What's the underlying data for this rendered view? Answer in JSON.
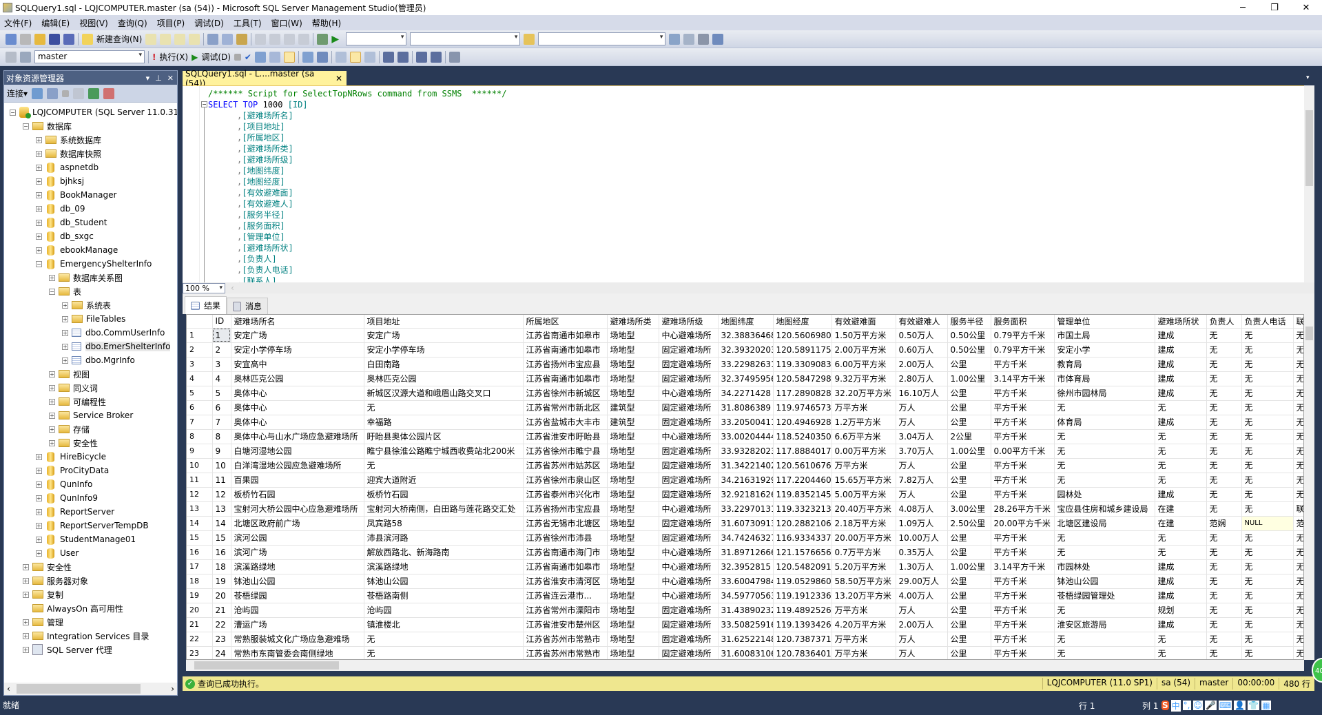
{
  "window": {
    "title": "SQLQuery1.sql - LQJCOMPUTER.master (sa (54)) - Microsoft SQL Server Management Studio(管理员)"
  },
  "menu": [
    "文件(F)",
    "编辑(E)",
    "视图(V)",
    "查询(Q)",
    "项目(P)",
    "调试(D)",
    "工具(T)",
    "窗口(W)",
    "帮助(H)"
  ],
  "toolbar1": {
    "new_query": "新建查询(N)"
  },
  "toolbar2": {
    "database": "master",
    "execute": "执行(X)",
    "debug": "调试(D)"
  },
  "object_explorer": {
    "title": "对象资源管理器",
    "connect": "连接",
    "tree": [
      {
        "label": "LQJCOMPUTER (SQL Server 11.0.31",
        "level": 0,
        "icon": "server",
        "state": "expanded"
      },
      {
        "label": "数据库",
        "level": 1,
        "icon": "folder",
        "state": "expanded"
      },
      {
        "label": "系统数据库",
        "level": 2,
        "icon": "folder",
        "state": "collapsed"
      },
      {
        "label": "数据库快照",
        "level": 2,
        "icon": "folder",
        "state": "collapsed"
      },
      {
        "label": "aspnetdb",
        "level": 2,
        "icon": "database",
        "state": "collapsed"
      },
      {
        "label": "bjhksj",
        "level": 2,
        "icon": "database",
        "state": "collapsed"
      },
      {
        "label": "BookManager",
        "level": 2,
        "icon": "database",
        "state": "collapsed"
      },
      {
        "label": "db_09",
        "level": 2,
        "icon": "database",
        "state": "collapsed"
      },
      {
        "label": "db_Student",
        "level": 2,
        "icon": "database",
        "state": "collapsed"
      },
      {
        "label": "db_sxgc",
        "level": 2,
        "icon": "database",
        "state": "collapsed"
      },
      {
        "label": "ebookManage",
        "level": 2,
        "icon": "database",
        "state": "collapsed"
      },
      {
        "label": "EmergencyShelterInfo",
        "level": 2,
        "icon": "database",
        "state": "expanded"
      },
      {
        "label": "数据库关系图",
        "level": 3,
        "icon": "folder",
        "state": "collapsed"
      },
      {
        "label": "表",
        "level": 3,
        "icon": "folder",
        "state": "expanded"
      },
      {
        "label": "系统表",
        "level": 4,
        "icon": "folder",
        "state": "collapsed"
      },
      {
        "label": "FileTables",
        "level": 4,
        "icon": "folder",
        "state": "collapsed"
      },
      {
        "label": "dbo.CommUserInfo",
        "level": 4,
        "icon": "table",
        "state": "collapsed"
      },
      {
        "label": "dbo.EmerShelterInfo",
        "level": 4,
        "icon": "table",
        "state": "collapsed",
        "selected": true
      },
      {
        "label": "dbo.MgrInfo",
        "level": 4,
        "icon": "table",
        "state": "collapsed"
      },
      {
        "label": "视图",
        "level": 3,
        "icon": "folder",
        "state": "collapsed"
      },
      {
        "label": "同义词",
        "level": 3,
        "icon": "folder",
        "state": "collapsed"
      },
      {
        "label": "可编程性",
        "level": 3,
        "icon": "folder",
        "state": "collapsed"
      },
      {
        "label": "Service Broker",
        "level": 3,
        "icon": "folder",
        "state": "collapsed"
      },
      {
        "label": "存储",
        "level": 3,
        "icon": "folder",
        "state": "collapsed"
      },
      {
        "label": "安全性",
        "level": 3,
        "icon": "folder",
        "state": "collapsed"
      },
      {
        "label": "HireBicycle",
        "level": 2,
        "icon": "database",
        "state": "collapsed"
      },
      {
        "label": "ProCityData",
        "level": 2,
        "icon": "database",
        "state": "collapsed"
      },
      {
        "label": "QunInfo",
        "level": 2,
        "icon": "database",
        "state": "collapsed"
      },
      {
        "label": "QunInfo9",
        "level": 2,
        "icon": "database",
        "state": "collapsed"
      },
      {
        "label": "ReportServer",
        "level": 2,
        "icon": "database",
        "state": "collapsed"
      },
      {
        "label": "ReportServerTempDB",
        "level": 2,
        "icon": "database",
        "state": "collapsed"
      },
      {
        "label": "StudentManage01",
        "level": 2,
        "icon": "database",
        "state": "collapsed"
      },
      {
        "label": "User",
        "level": 2,
        "icon": "database",
        "state": "collapsed"
      },
      {
        "label": "安全性",
        "level": 1,
        "icon": "folder",
        "state": "collapsed"
      },
      {
        "label": "服务器对象",
        "level": 1,
        "icon": "folder",
        "state": "collapsed"
      },
      {
        "label": "复制",
        "level": 1,
        "icon": "folder",
        "state": "collapsed"
      },
      {
        "label": "AlwaysOn 高可用性",
        "level": 1,
        "icon": "folder",
        "state": "none"
      },
      {
        "label": "管理",
        "level": 1,
        "icon": "folder",
        "state": "collapsed"
      },
      {
        "label": "Integration Services 目录",
        "level": 1,
        "icon": "folder",
        "state": "collapsed"
      },
      {
        "label": "SQL Server 代理",
        "level": 1,
        "icon": "agent",
        "state": "collapsed"
      }
    ]
  },
  "editor": {
    "tab_label": "SQLQuery1.sql - L....master (sa (54))",
    "comment": "/****** Script for SelectTopNRows command from SSMS  ******/",
    "select_kw": "SELECT",
    "top_kw": "TOP",
    "top_n": "1000",
    "first_col": "[ID]",
    "columns": [
      "[避难场所名]",
      "[项目地址]",
      "[所属地区]",
      "[避难场所类]",
      "[避难场所级]",
      "[地图纬度]",
      "[地图经度]",
      "[有效避难面]",
      "[有效避难人]",
      "[服务半径]",
      "[服务面积]",
      "[管理单位]",
      "[避难场所状]",
      "[负责人]",
      "[负责人电话]",
      "[联系人]"
    ],
    "zoom": "100 %"
  },
  "results": {
    "tabs": [
      "结果",
      "消息"
    ],
    "columns": [
      "",
      "ID",
      "避难场所名",
      "项目地址",
      "所属地区",
      "避难场所类",
      "避难场所级",
      "地图纬度",
      "地图经度",
      "有效避难面",
      "有效避难人",
      "服务半径",
      "服务面积",
      "管理单位",
      "避难场所状",
      "负责人",
      "负责人电话",
      "联"
    ],
    "rows": [
      [
        "1",
        "1",
        "安定广场",
        "安定广场",
        "江苏省南通市如皋市",
        "场地型",
        "中心避难场所",
        "32.38836468",
        "120.56069804",
        "1.50万平方米",
        "0.50万人",
        "0.50公里",
        "0.79平方千米",
        "市国土局",
        "建成",
        "无",
        "无",
        "无"
      ],
      [
        "2",
        "2",
        "安定小学停车场",
        "安定小学停车场",
        "江苏省南通市如皋市",
        "场地型",
        "固定避难场所",
        "32.39320203",
        "120.58911753",
        "2.00万平方米",
        "0.60万人",
        "0.50公里",
        "0.79平方千米",
        "安定小学",
        "建成",
        "无",
        "无",
        "无"
      ],
      [
        "3",
        "3",
        "安宜高中",
        "白田南路",
        "江苏省扬州市宝应县",
        "场地型",
        "固定避难场所",
        "33.22982631",
        "119.33090837",
        "6.00万平方米",
        "2.00万人",
        "公里",
        "平方千米",
        "教育局",
        "建成",
        "无",
        "无",
        "无"
      ],
      [
        "4",
        "4",
        "奥林匹克公园",
        "奥林匹克公园",
        "江苏省南通市如皋市",
        "场地型",
        "固定避难场所",
        "32.37495956",
        "120.58472987",
        "9.32万平方米",
        "2.80万人",
        "1.00公里",
        "3.14平方千米",
        "市体育局",
        "建成",
        "无",
        "无",
        "无"
      ],
      [
        "5",
        "5",
        "奥体中心",
        "新城区汉源大道和峨眉山路交叉口",
        "江苏省徐州市新城区",
        "场地型",
        "中心避难场所",
        "34.2271428",
        "117.28908282",
        "32.20万平方米",
        "16.10万人",
        "公里",
        "平方千米",
        "徐州市园林局",
        "建成",
        "无",
        "无",
        "无"
      ],
      [
        "6",
        "6",
        "奥体中心",
        "无",
        "江苏省常州市新北区",
        "建筑型",
        "固定避难场所",
        "31.8086389",
        "119.97465739",
        "万平方米",
        "万人",
        "公里",
        "平方千米",
        "无",
        "无",
        "无",
        "无",
        "无"
      ],
      [
        "7",
        "7",
        "奥体中心",
        "幸福路",
        "江苏省盐城市大丰市",
        "建筑型",
        "固定避难场所",
        "33.20500411",
        "120.49469285",
        "1.2万平方米",
        "万人",
        "公里",
        "平方千米",
        "体育局",
        "建成",
        "无",
        "无",
        "无"
      ],
      [
        "8",
        "8",
        "奥体中心与山水广场应急避难场所",
        "盱眙县奥体公园片区",
        "江苏省淮安市盱眙县",
        "场地型",
        "中心避难场所",
        "33.00204444",
        "118.52403504",
        "6.6万平方米",
        "3.04万人",
        "2公里",
        "平方千米",
        "无",
        "无",
        "无",
        "无",
        "无"
      ],
      [
        "9",
        "9",
        "白塘河湿地公园",
        "睢宁县徐淮公路睢宁城西收费站北200米",
        "江苏省徐州市睢宁县",
        "场地型",
        "固定避难场所",
        "33.93282023",
        "117.8884017",
        "0.00万平方米",
        "3.70万人",
        "1.00公里",
        "0.00平方千米",
        "无",
        "无",
        "无",
        "无",
        "无"
      ],
      [
        "10",
        "10",
        "白洋湾湿地公园应急避难场所",
        "无",
        "江苏省苏州市姑苏区",
        "场地型",
        "固定避难场所",
        "31.34221402",
        "120.56106761",
        "万平方米",
        "万人",
        "公里",
        "平方千米",
        "无",
        "无",
        "无",
        "无",
        "无"
      ],
      [
        "11",
        "11",
        "百果园",
        "迎宾大道附近",
        "江苏省徐州市泉山区",
        "场地型",
        "固定避难场所",
        "34.21631929",
        "117.22044609",
        "15.65万平方米",
        "7.82万人",
        "公里",
        "平方千米",
        "无",
        "无",
        "无",
        "无",
        "无"
      ],
      [
        "12",
        "12",
        "板桥竹石园",
        "板桥竹石园",
        "江苏省泰州市兴化市",
        "场地型",
        "固定避难场所",
        "32.92181626",
        "119.83521456",
        "5.00万平方米",
        "万人",
        "公里",
        "平方千米",
        "园林处",
        "建成",
        "无",
        "无",
        "无"
      ],
      [
        "13",
        "13",
        "宝射河大桥公园中心应急避难场所",
        "宝射河大桥南侧，白田路与莲花路交汇处",
        "江苏省扬州市宝应县",
        "场地型",
        "中心避难场所",
        "33.22970131",
        "119.33232137",
        "20.40万平方米",
        "4.08万人",
        "3.00公里",
        "28.26平方千米",
        "宝应县住房和城乡建设局",
        "在建",
        "无",
        "无",
        "联"
      ],
      [
        "14",
        "14",
        "北塘区政府前广场",
        "凤宾路58",
        "江苏省无锡市北塘区",
        "场地型",
        "固定避难场所",
        "31.60730913",
        "120.28821067",
        "2.18万平方米",
        "1.09万人",
        "2.50公里",
        "20.00平方千米",
        "北塘区建设局",
        "在建",
        "范娴",
        "NULL",
        "范"
      ],
      [
        "15",
        "15",
        "滨河公园",
        "沛县滨河路",
        "江苏省徐州市沛县",
        "场地型",
        "固定避难场所",
        "34.74246327",
        "116.93343372",
        "20.00万平方米",
        "10.00万人",
        "公里",
        "平方千米",
        "无",
        "无",
        "无",
        "无",
        "无"
      ],
      [
        "16",
        "16",
        "滨河广场",
        "解放西路北、新海路南",
        "江苏省南通市海门市",
        "场地型",
        "中心避难场所",
        "31.89712666",
        "121.15766569",
        "0.7万平方米",
        "0.35万人",
        "公里",
        "平方千米",
        "无",
        "无",
        "无",
        "无",
        "无"
      ],
      [
        "17",
        "18",
        "滨溪路绿地",
        "滨溪路绿地",
        "江苏省南通市如皋市",
        "场地型",
        "中心避难场所",
        "32.3952815",
        "120.54820913",
        "5.20万平方米",
        "1.30万人",
        "1.00公里",
        "3.14平方千米",
        "市园林处",
        "建成",
        "无",
        "无",
        "无"
      ],
      [
        "18",
        "19",
        "钵池山公园",
        "钵池山公园",
        "江苏省淮安市清河区",
        "场地型",
        "中心避难场所",
        "33.60047984",
        "119.05298601",
        "58.50万平方米",
        "29.00万人",
        "公里",
        "平方千米",
        "钵池山公园",
        "建成",
        "无",
        "无",
        "无"
      ],
      [
        "19",
        "20",
        "苍梧绿园",
        "苍梧路南侧",
        "江苏省连云港市...",
        "场地型",
        "中心避难场所",
        "34.59770563",
        "119.19123367",
        "13.20万平方米",
        "4.00万人",
        "公里",
        "平方千米",
        "苍梧绿园管理处",
        "建成",
        "无",
        "无",
        "无"
      ],
      [
        "20",
        "21",
        "沧屿园",
        "沧屿园",
        "江苏省常州市溧阳市",
        "场地型",
        "固定避难场所",
        "31.43890232",
        "119.48925266",
        "万平方米",
        "万人",
        "公里",
        "平方千米",
        "无",
        "规划",
        "无",
        "无",
        "无"
      ],
      [
        "21",
        "22",
        "漕运广场",
        "镇淮楼北",
        "江苏省淮安市楚州区",
        "场地型",
        "固定避难场所",
        "33.50825916",
        "119.13934265",
        "4.20万平方米",
        "2.00万人",
        "公里",
        "平方千米",
        "淮安区旅游局",
        "建成",
        "无",
        "无",
        "无"
      ],
      [
        "22",
        "23",
        "常熟服装城文化广场应急避难场",
        "无",
        "江苏省苏州市常熟市",
        "场地型",
        "固定避难场所",
        "31.62522148",
        "120.73873713",
        "万平方米",
        "万人",
        "公里",
        "平方千米",
        "无",
        "无",
        "无",
        "无",
        "无"
      ],
      [
        "23",
        "24",
        "常熟市东南管委会南侧绿地",
        "无",
        "江苏省苏州市常熟市",
        "场地型",
        "固定避难场所",
        "31.60083106",
        "120.78364013",
        "万平方米",
        "万人",
        "公里",
        "平方千米",
        "无",
        "无",
        "无",
        "无",
        "无"
      ]
    ]
  },
  "query_status": {
    "message": "查询已成功执行。",
    "server": "LQJCOMPUTER (11.0 SP1)",
    "user": "sa (54)",
    "database": "master",
    "elapsed": "00:00:00",
    "rows": "480 行"
  },
  "status_bar": {
    "ready": "就绪",
    "line": "行 1",
    "col": "列 1"
  },
  "ime": [
    "S",
    "中",
    "°,",
    "☺",
    "🎤",
    "⌨",
    "👤",
    "👕",
    "▦"
  ],
  "colors": {
    "frame": "#293955",
    "active_tab": "#fff29d",
    "query_status_bg": "#efe78f",
    "panel_header": "#4d6082"
  }
}
